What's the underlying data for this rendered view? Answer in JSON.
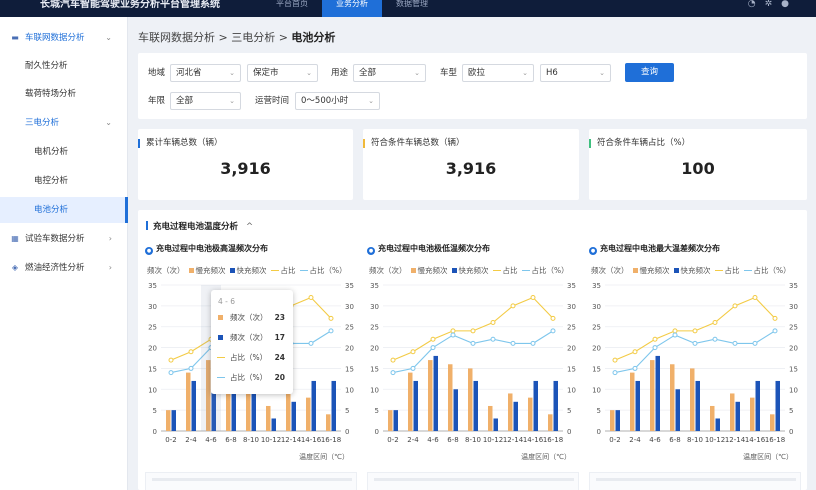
{
  "app": {
    "title": "长城汽车智能驾驶业务分析平台管理系统",
    "tabs": [
      "平台首页",
      "业务分析",
      "数据管理"
    ],
    "active_tab": 1
  },
  "sidebar": {
    "items": [
      {
        "label": "车联网数据分析",
        "level": 0,
        "icon": "car-icon",
        "arrow": "⌄",
        "state": "blue"
      },
      {
        "label": "耐久性分析",
        "level": 1,
        "state": ""
      },
      {
        "label": "载荷特场分析",
        "level": 1,
        "state": ""
      },
      {
        "label": "三电分析",
        "level": 1,
        "arrow": "⌄",
        "state": "blue"
      },
      {
        "label": "电机分析",
        "level": 2,
        "state": ""
      },
      {
        "label": "电控分析",
        "level": 2,
        "state": ""
      },
      {
        "label": "电池分析",
        "level": 2,
        "state": "active"
      },
      {
        "label": "试验车数据分析",
        "level": 0,
        "icon": "grid-icon",
        "arrow": "›",
        "state": ""
      },
      {
        "label": "燃油经济性分析",
        "level": 0,
        "icon": "gauge-icon",
        "arrow": "›",
        "state": ""
      }
    ]
  },
  "breadcrumb": {
    "path": "车联网数据分析 > 三电分析 > ",
    "current": "电池分析"
  },
  "filters": {
    "region_label": "地域",
    "province": "河北省",
    "city": "保定市",
    "usage_label": "用途",
    "usage": "全部",
    "model_label": "车型",
    "brand": "欧拉",
    "model": "H6",
    "query_button": "查询",
    "year_label": "年限",
    "year": "全部",
    "runtime_label": "运营时间",
    "runtime": "0～500小时"
  },
  "stats": [
    {
      "title": "累计车辆总数（辆）",
      "value": "3,916",
      "color": "#1f6fd8"
    },
    {
      "title": "符合条件车辆总数（辆）",
      "value": "3,916",
      "color": "#f0b93a"
    },
    {
      "title": "符合条件车辆占比（%）",
      "value": "100",
      "color": "#3fbf7f"
    }
  ],
  "section": {
    "title": "充电过程电池温度分析",
    "caret": "^"
  },
  "legend": {
    "y_left": "频次（次）",
    "slow": "慢充频次",
    "fast": "快充频次",
    "slow_pct": "占比",
    "fast_pct": "占比（%）"
  },
  "colors": {
    "slow": "#f0b06a",
    "fast": "#1c54b8",
    "slow_line": "#f3cb45",
    "fast_line": "#7ec6ec"
  },
  "chart_data": [
    {
      "type": "bar",
      "title": "充电过程中电池极高温频次分布",
      "xlabel": "温度区间（℃）",
      "ylabel": "频次（次）",
      "y2label": "占比（%）",
      "categories": [
        "0-2",
        "2-4",
        "4-6",
        "6-8",
        "8-10",
        "10-12",
        "12-14",
        "14-16",
        "16-18"
      ],
      "ylim": [
        0,
        35
      ],
      "y2lim": [
        0,
        35
      ],
      "series": [
        {
          "name": "慢充频次",
          "kind": "bar",
          "values": [
            5,
            14,
            17,
            16,
            15,
            6,
            9,
            8,
            4
          ]
        },
        {
          "name": "快充频次",
          "kind": "bar",
          "values": [
            5,
            12,
            18,
            10,
            12,
            3,
            7,
            12,
            12
          ]
        },
        {
          "name": "占比",
          "kind": "line",
          "values": [
            17,
            19,
            22,
            24,
            24,
            26,
            30,
            32,
            27
          ]
        },
        {
          "name": "占比（%）",
          "kind": "line",
          "values": [
            14,
            15,
            20,
            23,
            21,
            22,
            21,
            21,
            24
          ]
        }
      ]
    },
    {
      "type": "bar",
      "title": "充电过程中电池极低温频次分布",
      "xlabel": "温度区间（℃）",
      "ylabel": "频次（次）",
      "y2label": "占比（%）",
      "categories": [
        "0-2",
        "2-4",
        "4-6",
        "6-8",
        "8-10",
        "10-12",
        "12-14",
        "14-16",
        "16-18"
      ],
      "ylim": [
        0,
        35
      ],
      "y2lim": [
        0,
        35
      ],
      "series": [
        {
          "name": "慢充频次",
          "kind": "bar",
          "values": [
            5,
            14,
            17,
            16,
            15,
            6,
            9,
            8,
            4
          ]
        },
        {
          "name": "快充频次",
          "kind": "bar",
          "values": [
            5,
            12,
            18,
            10,
            12,
            3,
            7,
            12,
            12
          ]
        },
        {
          "name": "占比",
          "kind": "line",
          "values": [
            17,
            19,
            22,
            24,
            24,
            26,
            30,
            32,
            27
          ]
        },
        {
          "name": "占比（%）",
          "kind": "line",
          "values": [
            14,
            15,
            20,
            23,
            21,
            22,
            21,
            21,
            24
          ]
        }
      ]
    },
    {
      "type": "bar",
      "title": "充电过程中电池最大温差频次分布",
      "xlabel": "温度区间（℃）",
      "ylabel": "频次（次）",
      "y2label": "占比（%）",
      "categories": [
        "0-2",
        "2-4",
        "4-6",
        "6-8",
        "8-10",
        "10-12",
        "12-14",
        "14-16",
        "16-18"
      ],
      "ylim": [
        0,
        35
      ],
      "y2lim": [
        0,
        35
      ],
      "series": [
        {
          "name": "慢充频次",
          "kind": "bar",
          "values": [
            5,
            14,
            17,
            16,
            15,
            6,
            9,
            8,
            4
          ]
        },
        {
          "name": "快充频次",
          "kind": "bar",
          "values": [
            5,
            12,
            18,
            10,
            12,
            3,
            7,
            12,
            12
          ]
        },
        {
          "name": "占比",
          "kind": "line",
          "values": [
            17,
            19,
            22,
            24,
            24,
            26,
            30,
            32,
            27
          ]
        },
        {
          "name": "占比（%）",
          "kind": "line",
          "values": [
            14,
            15,
            20,
            23,
            21,
            22,
            21,
            21,
            24
          ]
        }
      ]
    }
  ],
  "tooltip": {
    "header": "4 - 6",
    "rows": [
      {
        "label": "频次（次）",
        "value": "23",
        "marker": "bar",
        "color": "#f0b06a"
      },
      {
        "label": "频次（次）",
        "value": "17",
        "marker": "bar",
        "color": "#1c54b8"
      },
      {
        "label": "占比（%）",
        "value": "24",
        "marker": "line",
        "color": "#f3cb45"
      },
      {
        "label": "占比（%）",
        "value": "20",
        "marker": "line",
        "color": "#7ec6ec"
      }
    ]
  }
}
